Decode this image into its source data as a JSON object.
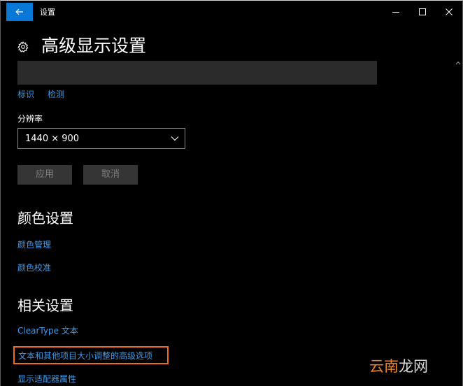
{
  "window": {
    "app_title": "设置",
    "back_icon": "back-arrow-icon",
    "minimize_icon": "minimize-icon",
    "maximize_icon": "maximize-icon",
    "close_icon": "close-icon"
  },
  "header": {
    "icon": "gear-icon",
    "title": "高级显示设置"
  },
  "display": {
    "identify_link": "标识",
    "detect_link": "检测",
    "resolution_label": "分辨率",
    "resolution_value": "1440 × 900",
    "apply_button": "应用",
    "cancel_button": "取消"
  },
  "color_settings": {
    "title": "颜色设置",
    "links": [
      "颜色管理",
      "颜色校准"
    ]
  },
  "related_settings": {
    "title": "相关设置",
    "links": [
      "ClearType 文本",
      "文本和其他项目大小调整的高级选项",
      "显示适配器属性"
    ]
  },
  "watermark": {
    "part1": "云南",
    "part2": "龙网"
  },
  "colors": {
    "accent": "#0a78d7",
    "link": "#3f9ae8",
    "highlight_border": "#f06a1c",
    "background": "#000000"
  }
}
